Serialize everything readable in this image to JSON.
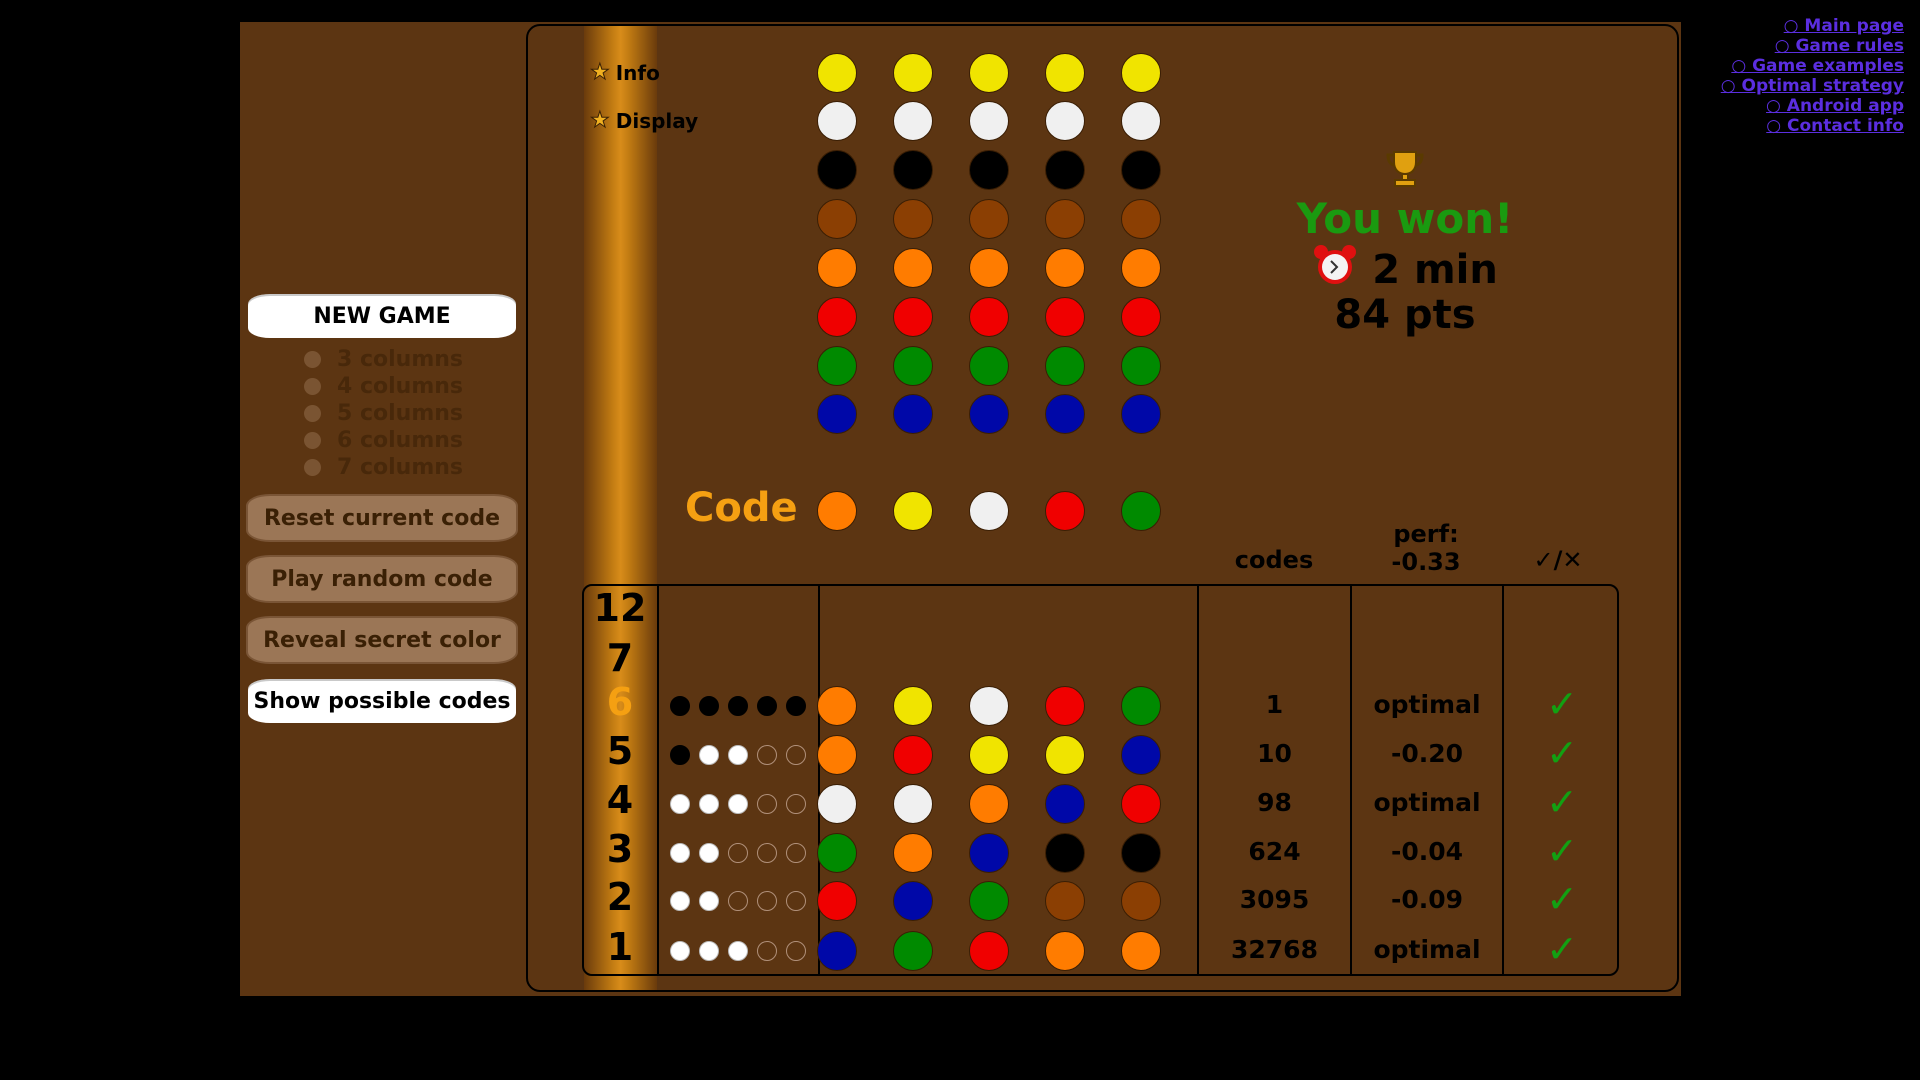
{
  "nav_links": [
    {
      "label": "○ Main page"
    },
    {
      "label": "○ Game rules"
    },
    {
      "label": "○ Game examples"
    },
    {
      "label": "○ Optimal strategy"
    },
    {
      "label": "○ Android app"
    },
    {
      "label": "○ Contact info"
    }
  ],
  "sidebar": {
    "new_game": "NEW GAME",
    "column_options": [
      "3 columns",
      "4 columns",
      "5 columns",
      "6 columns",
      "7 columns"
    ],
    "buttons": [
      "Reset current code",
      "Play random code",
      "Reveal secret color",
      "Show possible codes"
    ]
  },
  "menu": {
    "info": "Info",
    "display": "Display"
  },
  "palette": [
    "yellow",
    "white",
    "black",
    "brown",
    "orange",
    "red",
    "green",
    "blue"
  ],
  "colors": {
    "yellow": "#f0e400",
    "white": "#f0f0f0",
    "black": "#000000",
    "brown": "#8b3f03",
    "orange": "#ff7c00",
    "red": "#f00000",
    "green": "#008a00",
    "blue": "#0008a8",
    "accent": "#f5a012",
    "win": "#1a9a10"
  },
  "code": {
    "label": "Code",
    "pegs": [
      "orange",
      "yellow",
      "white",
      "red",
      "green"
    ]
  },
  "result": {
    "trophy_icon": "trophy-icon",
    "message": "You won!",
    "clock_icon": "alarm-clock-icon",
    "time": "2 min",
    "points": "84 pts"
  },
  "table": {
    "headers": {
      "codes": "codes",
      "perf_label": "perf:",
      "perf_value": "-0.33",
      "check": "✓/✕"
    },
    "empty_rows": [
      "12",
      "7"
    ],
    "rows": [
      {
        "num": "6",
        "feedback": [
          "black",
          "black",
          "black",
          "black",
          "black"
        ],
        "pegs": [
          "orange",
          "yellow",
          "white",
          "red",
          "green"
        ],
        "codes": "1",
        "perf": "optimal",
        "ok": "✓",
        "current": true
      },
      {
        "num": "5",
        "feedback": [
          "black",
          "white",
          "white",
          "empty",
          "empty"
        ],
        "pegs": [
          "orange",
          "red",
          "yellow",
          "yellow",
          "blue"
        ],
        "codes": "10",
        "perf": "-0.20",
        "ok": "✓"
      },
      {
        "num": "4",
        "feedback": [
          "white",
          "white",
          "white",
          "empty",
          "empty"
        ],
        "pegs": [
          "white",
          "white",
          "orange",
          "blue",
          "red"
        ],
        "codes": "98",
        "perf": "optimal",
        "ok": "✓"
      },
      {
        "num": "3",
        "feedback": [
          "white",
          "white",
          "empty",
          "empty",
          "empty"
        ],
        "pegs": [
          "green",
          "orange",
          "blue",
          "black",
          "black"
        ],
        "codes": "624",
        "perf": "-0.04",
        "ok": "✓"
      },
      {
        "num": "2",
        "feedback": [
          "white",
          "white",
          "empty",
          "empty",
          "empty"
        ],
        "pegs": [
          "red",
          "blue",
          "green",
          "brown",
          "brown"
        ],
        "codes": "3095",
        "perf": "-0.09",
        "ok": "✓"
      },
      {
        "num": "1",
        "feedback": [
          "white",
          "white",
          "white",
          "empty",
          "empty"
        ],
        "pegs": [
          "blue",
          "green",
          "red",
          "orange",
          "orange"
        ],
        "codes": "32768",
        "perf": "optimal",
        "ok": "✓"
      }
    ]
  }
}
